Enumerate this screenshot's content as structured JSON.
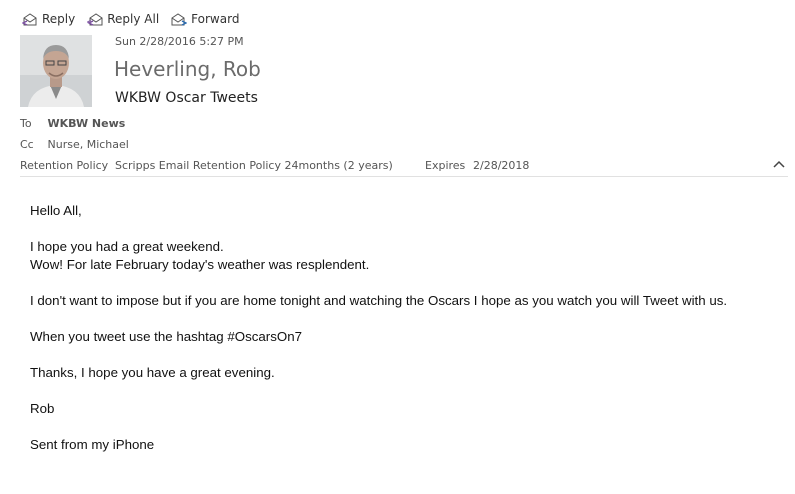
{
  "toolbar": {
    "reply_label": "Reply",
    "reply_all_label": "Reply All",
    "forward_label": "Forward"
  },
  "header": {
    "date": "Sun 2/28/2016 5:27 PM",
    "sender": "Heverling, Rob",
    "subject": "WKBW Oscar Tweets",
    "to_label": "To",
    "to_value": "WKBW News",
    "cc_label": "Cc",
    "cc_value": "Nurse, Michael",
    "retention_label": "Retention Policy",
    "retention_value": "Scripps Email Retention Policy 24months (2 years)",
    "expires_label": "Expires",
    "expires_value": "2/28/2018"
  },
  "body": {
    "greeting": "Hello All,",
    "line1": "I hope you had a great weekend.",
    "line2": "Wow! For late February today's weather was resplendent.",
    "line3": "I don't want to impose but if you are home tonight and watching the Oscars I hope as you watch you will Tweet with us.",
    "line4": "When you tweet use the hashtag #OscarsOn7",
    "line5": "Thanks, I hope you have a great evening.",
    "signature": "Rob",
    "footer": "Sent from my iPhone"
  },
  "icons": {
    "reply": "reply-icon",
    "reply_all": "reply-all-icon",
    "forward": "forward-icon",
    "collapse": "chevron-up-icon"
  }
}
